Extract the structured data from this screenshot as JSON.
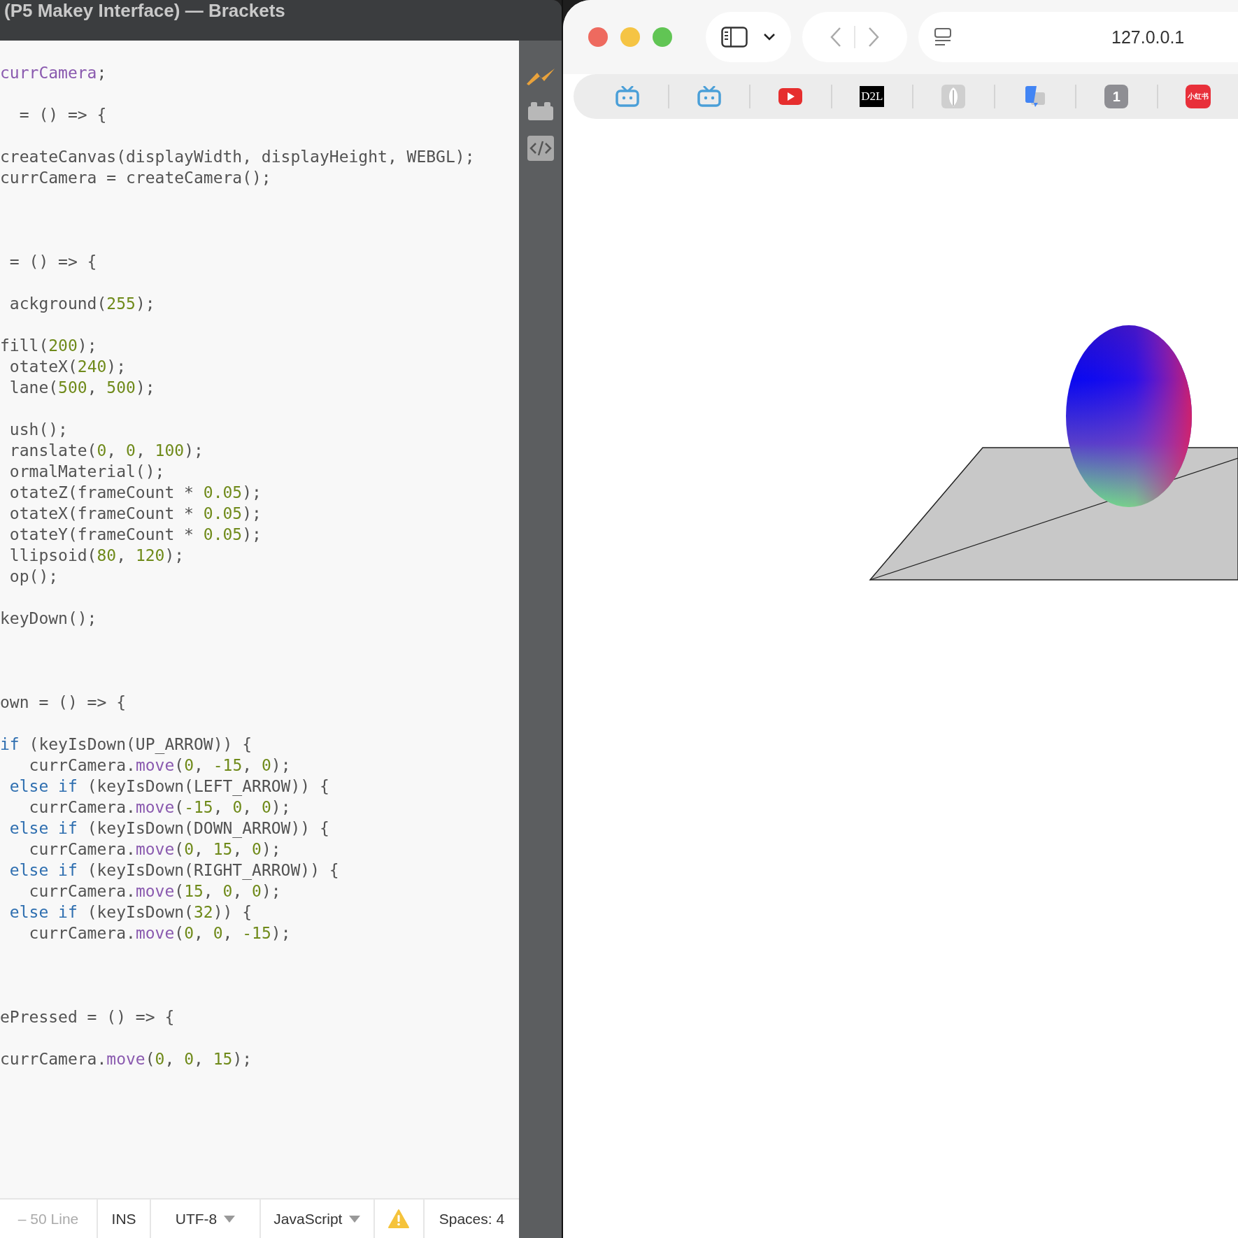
{
  "editor": {
    "title": "(P5 Makey Interface) — Brackets",
    "lines": [
      {
        "kind": "code",
        "tokens": [
          {
            "kind": "var",
            "text": "currCamera"
          },
          {
            "kind": "plain",
            "text": ";"
          }
        ]
      },
      {
        "kind": "blank"
      },
      {
        "kind": "code",
        "tokens": [
          {
            "kind": "plain",
            "text": "  = () => {"
          }
        ]
      },
      {
        "kind": "blank"
      },
      {
        "kind": "code",
        "tokens": [
          {
            "kind": "plain",
            "text": "createCanvas(displayWidth, displayHeight, WEBGL);"
          }
        ]
      },
      {
        "kind": "code",
        "tokens": [
          {
            "kind": "plain",
            "text": "currCamera = createCamera();"
          }
        ]
      },
      {
        "kind": "blank"
      },
      {
        "kind": "blank"
      },
      {
        "kind": "blank"
      },
      {
        "kind": "code",
        "tokens": [
          {
            "kind": "plain",
            "text": " = () => {"
          }
        ]
      },
      {
        "kind": "blank"
      },
      {
        "kind": "code",
        "tokens": [
          {
            "kind": "plain",
            "text": " ackground("
          },
          {
            "kind": "num",
            "text": "255"
          },
          {
            "kind": "plain",
            "text": ");"
          }
        ]
      },
      {
        "kind": "blank"
      },
      {
        "kind": "code",
        "tokens": [
          {
            "kind": "plain",
            "text": "fill("
          },
          {
            "kind": "num",
            "text": "200"
          },
          {
            "kind": "plain",
            "text": ");"
          }
        ]
      },
      {
        "kind": "code",
        "tokens": [
          {
            "kind": "plain",
            "text": " otateX("
          },
          {
            "kind": "num",
            "text": "240"
          },
          {
            "kind": "plain",
            "text": ");"
          }
        ]
      },
      {
        "kind": "code",
        "tokens": [
          {
            "kind": "plain",
            "text": " lane("
          },
          {
            "kind": "num",
            "text": "500"
          },
          {
            "kind": "plain",
            "text": ", "
          },
          {
            "kind": "num",
            "text": "500"
          },
          {
            "kind": "plain",
            "text": ");"
          }
        ]
      },
      {
        "kind": "blank"
      },
      {
        "kind": "code",
        "tokens": [
          {
            "kind": "plain",
            "text": " ush();"
          }
        ]
      },
      {
        "kind": "code",
        "tokens": [
          {
            "kind": "plain",
            "text": " ranslate("
          },
          {
            "kind": "num",
            "text": "0"
          },
          {
            "kind": "plain",
            "text": ", "
          },
          {
            "kind": "num",
            "text": "0"
          },
          {
            "kind": "plain",
            "text": ", "
          },
          {
            "kind": "num",
            "text": "100"
          },
          {
            "kind": "plain",
            "text": ");"
          }
        ]
      },
      {
        "kind": "code",
        "tokens": [
          {
            "kind": "plain",
            "text": " ormalMaterial();"
          }
        ]
      },
      {
        "kind": "code",
        "tokens": [
          {
            "kind": "plain",
            "text": " otateZ(frameCount * "
          },
          {
            "kind": "num",
            "text": "0.05"
          },
          {
            "kind": "plain",
            "text": ");"
          }
        ]
      },
      {
        "kind": "code",
        "tokens": [
          {
            "kind": "plain",
            "text": " otateX(frameCount * "
          },
          {
            "kind": "num",
            "text": "0.05"
          },
          {
            "kind": "plain",
            "text": ");"
          }
        ]
      },
      {
        "kind": "code",
        "tokens": [
          {
            "kind": "plain",
            "text": " otateY(frameCount * "
          },
          {
            "kind": "num",
            "text": "0.05"
          },
          {
            "kind": "plain",
            "text": ");"
          }
        ]
      },
      {
        "kind": "code",
        "tokens": [
          {
            "kind": "plain",
            "text": " llipsoid("
          },
          {
            "kind": "num",
            "text": "80"
          },
          {
            "kind": "plain",
            "text": ", "
          },
          {
            "kind": "num",
            "text": "120"
          },
          {
            "kind": "plain",
            "text": ");"
          }
        ]
      },
      {
        "kind": "code",
        "tokens": [
          {
            "kind": "plain",
            "text": " op();"
          }
        ]
      },
      {
        "kind": "blank"
      },
      {
        "kind": "code",
        "tokens": [
          {
            "kind": "plain",
            "text": "keyDown();"
          }
        ]
      },
      {
        "kind": "blank"
      },
      {
        "kind": "blank"
      },
      {
        "kind": "blank"
      },
      {
        "kind": "code",
        "tokens": [
          {
            "kind": "plain",
            "text": "own = () => {"
          }
        ]
      },
      {
        "kind": "blank"
      },
      {
        "kind": "code",
        "tokens": [
          {
            "kind": "kw",
            "text": "if"
          },
          {
            "kind": "plain",
            "text": " (keyIsDown(UP_ARROW)) {"
          }
        ]
      },
      {
        "kind": "code",
        "tokens": [
          {
            "kind": "plain",
            "text": "   currCamera."
          },
          {
            "kind": "var",
            "text": "move"
          },
          {
            "kind": "plain",
            "text": "("
          },
          {
            "kind": "num",
            "text": "0"
          },
          {
            "kind": "plain",
            "text": ", "
          },
          {
            "kind": "num",
            "text": "-15"
          },
          {
            "kind": "plain",
            "text": ", "
          },
          {
            "kind": "num",
            "text": "0"
          },
          {
            "kind": "plain",
            "text": ");"
          }
        ]
      },
      {
        "kind": "code",
        "tokens": [
          {
            "kind": "kw",
            "text": " else"
          },
          {
            "kind": "kw",
            "text": " if"
          },
          {
            "kind": "plain",
            "text": " (keyIsDown(LEFT_ARROW)) {"
          }
        ]
      },
      {
        "kind": "code",
        "tokens": [
          {
            "kind": "plain",
            "text": "   currCamera."
          },
          {
            "kind": "var",
            "text": "move"
          },
          {
            "kind": "plain",
            "text": "("
          },
          {
            "kind": "num",
            "text": "-15"
          },
          {
            "kind": "plain",
            "text": ", "
          },
          {
            "kind": "num",
            "text": "0"
          },
          {
            "kind": "plain",
            "text": ", "
          },
          {
            "kind": "num",
            "text": "0"
          },
          {
            "kind": "plain",
            "text": ");"
          }
        ]
      },
      {
        "kind": "code",
        "tokens": [
          {
            "kind": "kw",
            "text": " else"
          },
          {
            "kind": "kw",
            "text": " if"
          },
          {
            "kind": "plain",
            "text": " (keyIsDown(DOWN_ARROW)) {"
          }
        ]
      },
      {
        "kind": "code",
        "tokens": [
          {
            "kind": "plain",
            "text": "   currCamera."
          },
          {
            "kind": "var",
            "text": "move"
          },
          {
            "kind": "plain",
            "text": "("
          },
          {
            "kind": "num",
            "text": "0"
          },
          {
            "kind": "plain",
            "text": ", "
          },
          {
            "kind": "num",
            "text": "15"
          },
          {
            "kind": "plain",
            "text": ", "
          },
          {
            "kind": "num",
            "text": "0"
          },
          {
            "kind": "plain",
            "text": ");"
          }
        ]
      },
      {
        "kind": "code",
        "tokens": [
          {
            "kind": "kw",
            "text": " else"
          },
          {
            "kind": "kw",
            "text": " if"
          },
          {
            "kind": "plain",
            "text": " (keyIsDown(RIGHT_ARROW)) {"
          }
        ]
      },
      {
        "kind": "code",
        "tokens": [
          {
            "kind": "plain",
            "text": "   currCamera."
          },
          {
            "kind": "var",
            "text": "move"
          },
          {
            "kind": "plain",
            "text": "("
          },
          {
            "kind": "num",
            "text": "15"
          },
          {
            "kind": "plain",
            "text": ", "
          },
          {
            "kind": "num",
            "text": "0"
          },
          {
            "kind": "plain",
            "text": ", "
          },
          {
            "kind": "num",
            "text": "0"
          },
          {
            "kind": "plain",
            "text": ");"
          }
        ]
      },
      {
        "kind": "code",
        "tokens": [
          {
            "kind": "kw",
            "text": " else"
          },
          {
            "kind": "kw",
            "text": " if"
          },
          {
            "kind": "plain",
            "text": " (keyIsDown("
          },
          {
            "kind": "num",
            "text": "32"
          },
          {
            "kind": "plain",
            "text": ")) {"
          }
        ]
      },
      {
        "kind": "code",
        "tokens": [
          {
            "kind": "plain",
            "text": "   currCamera."
          },
          {
            "kind": "var",
            "text": "move"
          },
          {
            "kind": "plain",
            "text": "("
          },
          {
            "kind": "num",
            "text": "0"
          },
          {
            "kind": "plain",
            "text": ", "
          },
          {
            "kind": "num",
            "text": "0"
          },
          {
            "kind": "plain",
            "text": ", "
          },
          {
            "kind": "num",
            "text": "-15"
          },
          {
            "kind": "plain",
            "text": ");"
          }
        ]
      },
      {
        "kind": "blank"
      },
      {
        "kind": "blank"
      },
      {
        "kind": "blank"
      },
      {
        "kind": "code",
        "tokens": [
          {
            "kind": "plain",
            "text": "ePressed = () => {"
          }
        ]
      },
      {
        "kind": "blank"
      },
      {
        "kind": "code",
        "tokens": [
          {
            "kind": "plain",
            "text": "currCamera."
          },
          {
            "kind": "var",
            "text": "move"
          },
          {
            "kind": "plain",
            "text": "("
          },
          {
            "kind": "num",
            "text": "0"
          },
          {
            "kind": "plain",
            "text": ", "
          },
          {
            "kind": "num",
            "text": "0"
          },
          {
            "kind": "plain",
            "text": ", "
          },
          {
            "kind": "num",
            "text": "15"
          },
          {
            "kind": "plain",
            "text": ");"
          }
        ]
      }
    ],
    "status_bar": [
      {
        "kind": "muted",
        "text": "– 50 Line"
      },
      {
        "kind": "text",
        "text": "INS"
      },
      {
        "kind": "dropdown",
        "text": "UTF-8"
      },
      {
        "kind": "dropdown",
        "text": "JavaScript"
      },
      {
        "kind": "warning"
      },
      {
        "kind": "text",
        "text": "Spaces: 4"
      }
    ]
  },
  "browser": {
    "address": "127.0.0.1",
    "bookmarks": [
      {
        "kind": "tv"
      },
      {
        "kind": "tv"
      },
      {
        "kind": "play"
      },
      {
        "kind": "logo",
        "text": "D2L"
      },
      {
        "kind": "leaf"
      },
      {
        "kind": "translate"
      },
      {
        "kind": "badge",
        "text": "1",
        "color": "#8e8e93"
      },
      {
        "kind": "badge",
        "text": "小红书",
        "color": "#e8303a"
      }
    ]
  }
}
